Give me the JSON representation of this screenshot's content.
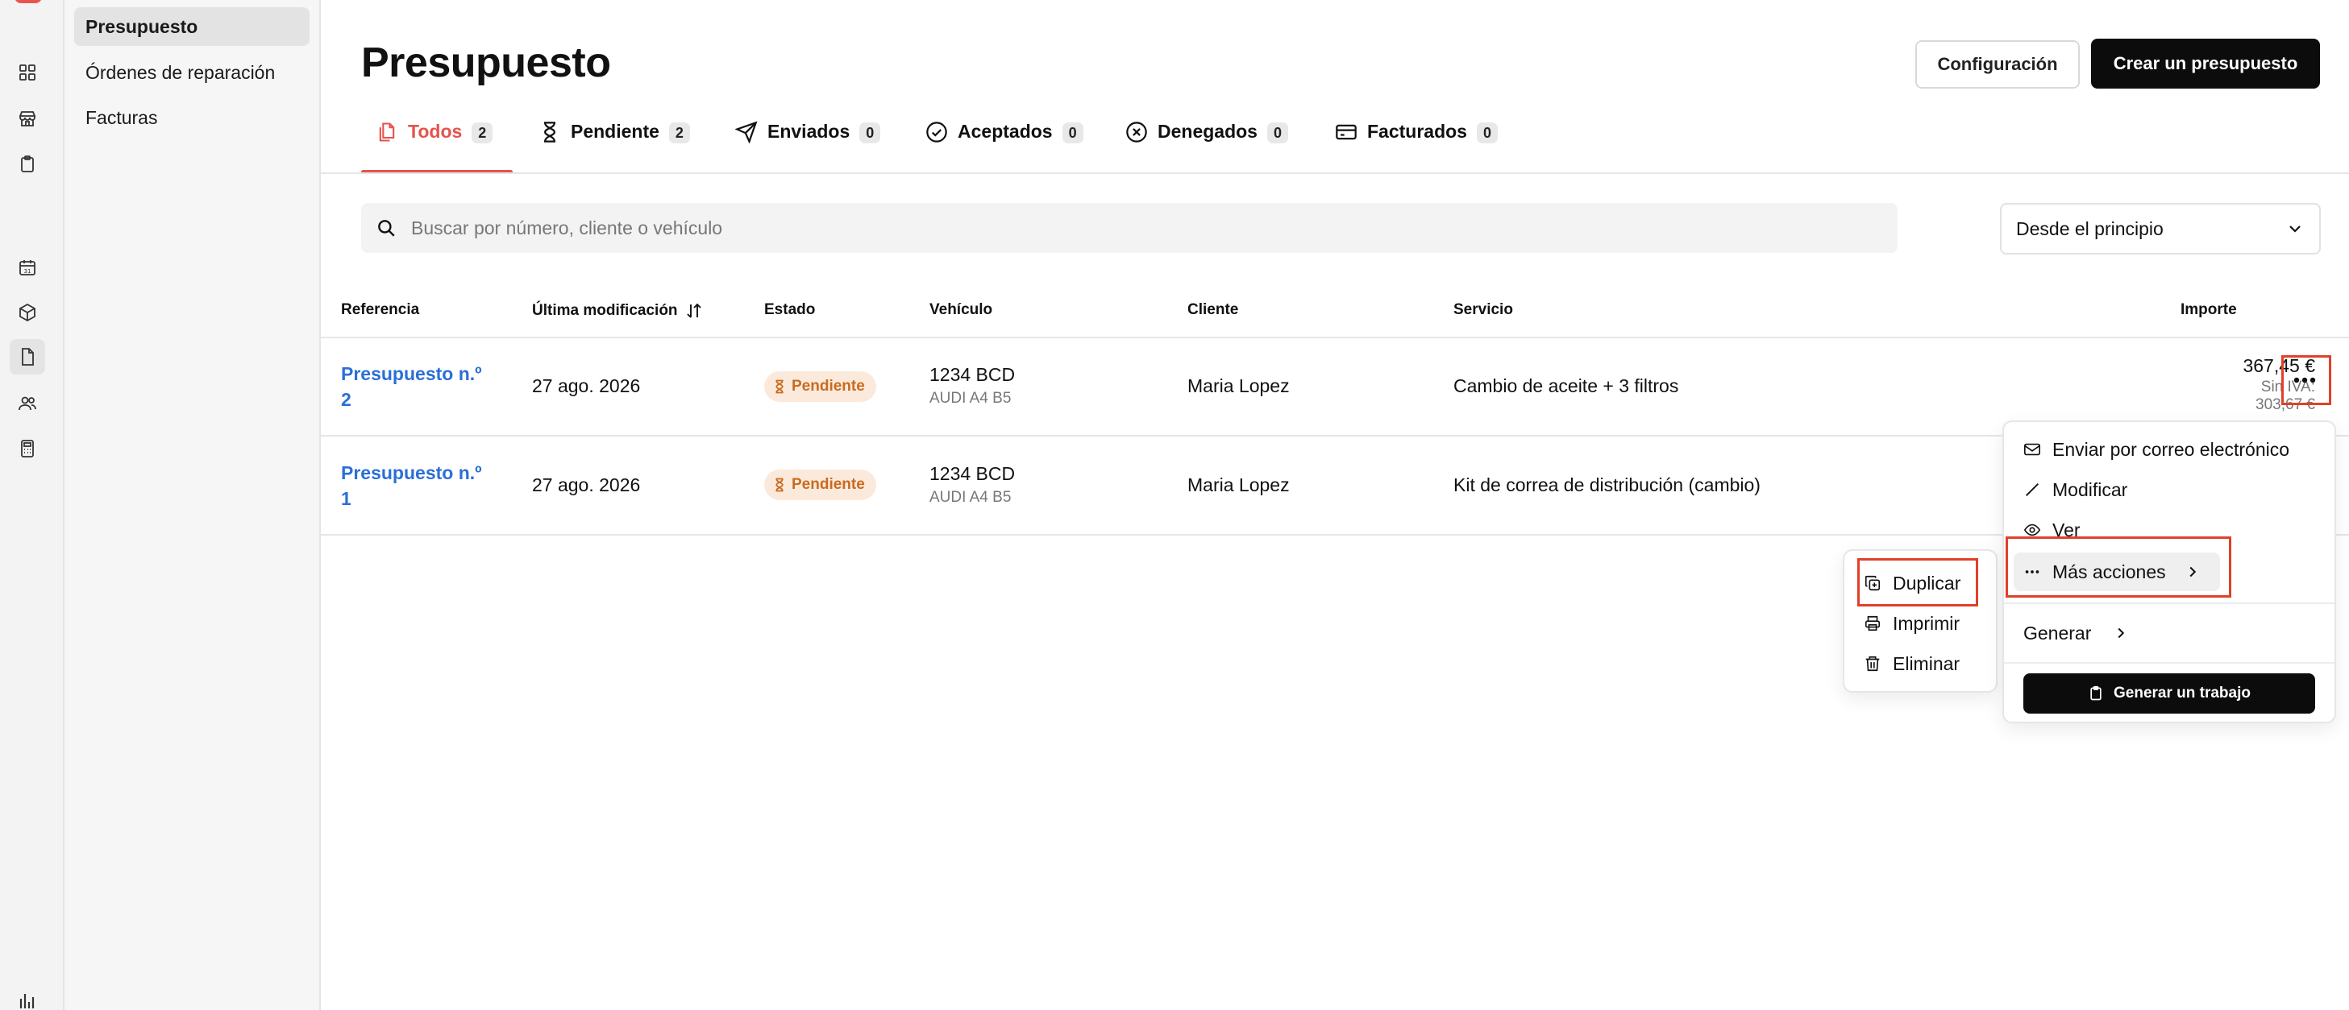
{
  "sidebar": {
    "items": [
      {
        "label": "Presupuesto",
        "active": true
      },
      {
        "label": "Órdenes de reparación",
        "active": false
      },
      {
        "label": "Facturas",
        "active": false
      }
    ]
  },
  "rail": {
    "icons": [
      "dashboard-icon",
      "store-icon",
      "clipboard-icon",
      "calendar-icon",
      "box-icon",
      "document-icon",
      "users-icon",
      "calculator-icon",
      "chart-icon"
    ]
  },
  "header": {
    "title": "Presupuesto",
    "config_label": "Configuración",
    "create_label": "Crear un presupuesto"
  },
  "tabs": [
    {
      "label": "Todos",
      "count": "2",
      "active": true
    },
    {
      "label": "Pendiente",
      "count": "2"
    },
    {
      "label": "Enviados",
      "count": "0"
    },
    {
      "label": "Aceptados",
      "count": "0"
    },
    {
      "label": "Denegados",
      "count": "0"
    },
    {
      "label": "Facturados",
      "count": "0"
    }
  ],
  "search": {
    "placeholder": "Buscar por número, cliente o vehículo"
  },
  "period_select": {
    "value": "Desde el principio"
  },
  "table": {
    "columns": [
      "Referencia",
      "Última modificación",
      "Estado",
      "Vehículo",
      "Cliente",
      "Servicio",
      "Importe"
    ],
    "rows": [
      {
        "ref_line1": "Presupuesto n.º",
        "ref_line2": "2",
        "modified": "27 ago. 2026",
        "status": "Pendiente",
        "plate": "1234 BCD",
        "model": "AUDI A4 B5",
        "client": "Maria Lopez",
        "service": "Cambio de aceite + 3 filtros",
        "amount": "367,45 €",
        "tax_label": "Sin IVA:",
        "net_amount": "303,67 €"
      },
      {
        "ref_line1": "Presupuesto n.º",
        "ref_line2": "1",
        "modified": "27 ago. 2026",
        "status": "Pendiente",
        "plate": "1234 BCD",
        "model": "AUDI A4 B5",
        "client": "Maria Lopez",
        "service": "Kit de correa de distribución (cambio)"
      }
    ]
  },
  "row_menu": {
    "send_email": "Enviar por correo electrónico",
    "modify": "Modificar",
    "view": "Ver",
    "more_actions": "Más acciones",
    "generate": "Generar",
    "generate_job": "Generar un trabajo"
  },
  "sub_menu": {
    "duplicate": "Duplicar",
    "print": "Imprimir",
    "delete": "Eliminar"
  },
  "colors": {
    "accent": "#e5534b",
    "link": "#2a6fd6",
    "badge_bg": "#fbeadc",
    "badge_text": "#c96b1f",
    "annotation": "#e0402a"
  }
}
